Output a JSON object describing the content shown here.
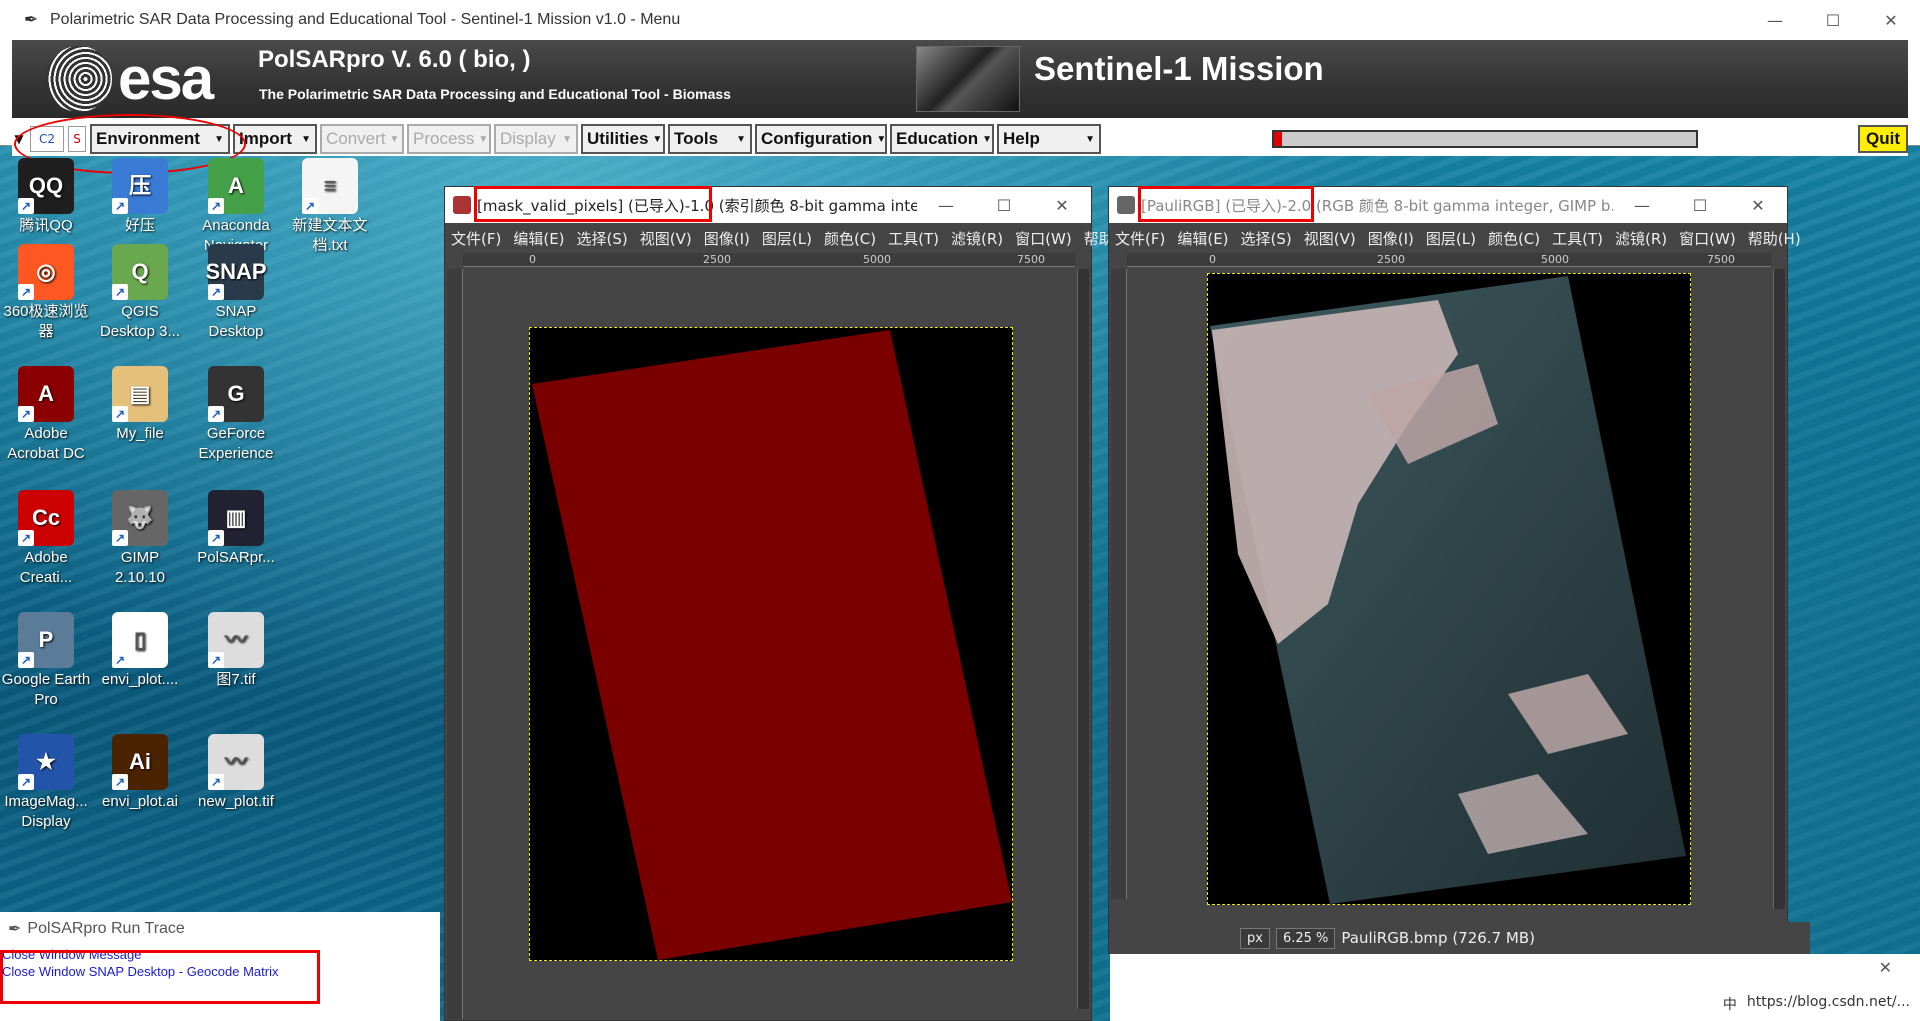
{
  "main_window": {
    "title": "Polarimetric SAR Data Processing and Educational Tool - Sentinel-1 Mission v1.0 - Menu",
    "banner": {
      "logo": "esa",
      "title": "PolSARpro V. 6.0 ( bio, )",
      "subtitle": "The Polarimetric SAR Data Processing and Educational Tool - Biomass",
      "mission": "Sentinel-1 Mission"
    },
    "menu": {
      "dataset": "C2",
      "mode": "S",
      "items": [
        {
          "label": "Environment",
          "enabled": true
        },
        {
          "label": "Import",
          "enabled": true
        },
        {
          "label": "Convert",
          "enabled": false
        },
        {
          "label": "Process",
          "enabled": false
        },
        {
          "label": "Display",
          "enabled": false
        },
        {
          "label": "Utilities",
          "enabled": true
        },
        {
          "label": "Tools",
          "enabled": true
        },
        {
          "label": "Configuration",
          "enabled": true
        },
        {
          "label": "Education",
          "enabled": true
        },
        {
          "label": "Help",
          "enabled": true
        }
      ],
      "progress": 0.02,
      "quit": "Quit"
    }
  },
  "desktop_icons": [
    {
      "label": "腾讯QQ"
    },
    {
      "label": "好压"
    },
    {
      "label": "Anaconda Navigator"
    },
    {
      "label": "新建文本文档.txt"
    },
    {
      "label": "360极速浏览器"
    },
    {
      "label": "QGIS Desktop 3..."
    },
    {
      "label": "SNAP Desktop"
    },
    {
      "label": "Adobe Acrobat DC"
    },
    {
      "label": "My_file"
    },
    {
      "label": "GeForce Experience"
    },
    {
      "label": "Adobe Creati..."
    },
    {
      "label": "GIMP 2.10.10"
    },
    {
      "label": "PolSARpr..."
    },
    {
      "label": "Google Earth Pro"
    },
    {
      "label": "envi_plot...."
    },
    {
      "label": "图7.tif"
    },
    {
      "label": "ImageMag... Display"
    },
    {
      "label": "envi_plot.ai"
    },
    {
      "label": "new_plot.tif"
    }
  ],
  "gimp_mask": {
    "title": "[mask_valid_pixels] (已导入)-1.0 (索引颜色 8-bit gamma inte...",
    "menu": [
      "文件(F)",
      "编辑(E)",
      "选择(S)",
      "视图(V)",
      "图像(I)",
      "图层(L)",
      "颜色(C)",
      "工具(T)",
      "滤镜(R)",
      "窗口(W)",
      "帮助"
    ],
    "ruler_ticks": [
      "0",
      "2500",
      "5000",
      "7500"
    ],
    "fill_color": "#7a0000"
  },
  "gimp_pauli": {
    "title": "[PauliRGB] (已导入)-2.0 (RGB 颜色 8-bit gamma integer, GIMP b...",
    "menu": [
      "文件(F)",
      "编辑(E)",
      "选择(S)",
      "视图(V)",
      "图像(I)",
      "图层(L)",
      "颜色(C)",
      "工具(T)",
      "滤镜(R)",
      "窗口(W)",
      "帮助(H)"
    ],
    "ruler_ticks": [
      "0",
      "2500",
      "5000",
      "7500"
    ],
    "status": {
      "unit": "px",
      "zoom": "6.25 %",
      "file": "PauliRGB.bmp (726.7 MB)"
    }
  },
  "run_trace": {
    "title": "PolSARpro Run Trace",
    "lines": [
      "Close Window Message",
      "Close Window SNAP Desktop - Geocode Matrix"
    ]
  },
  "tray": {
    "ime": "中",
    "watermark": "https://blog.csdn.net/..."
  }
}
